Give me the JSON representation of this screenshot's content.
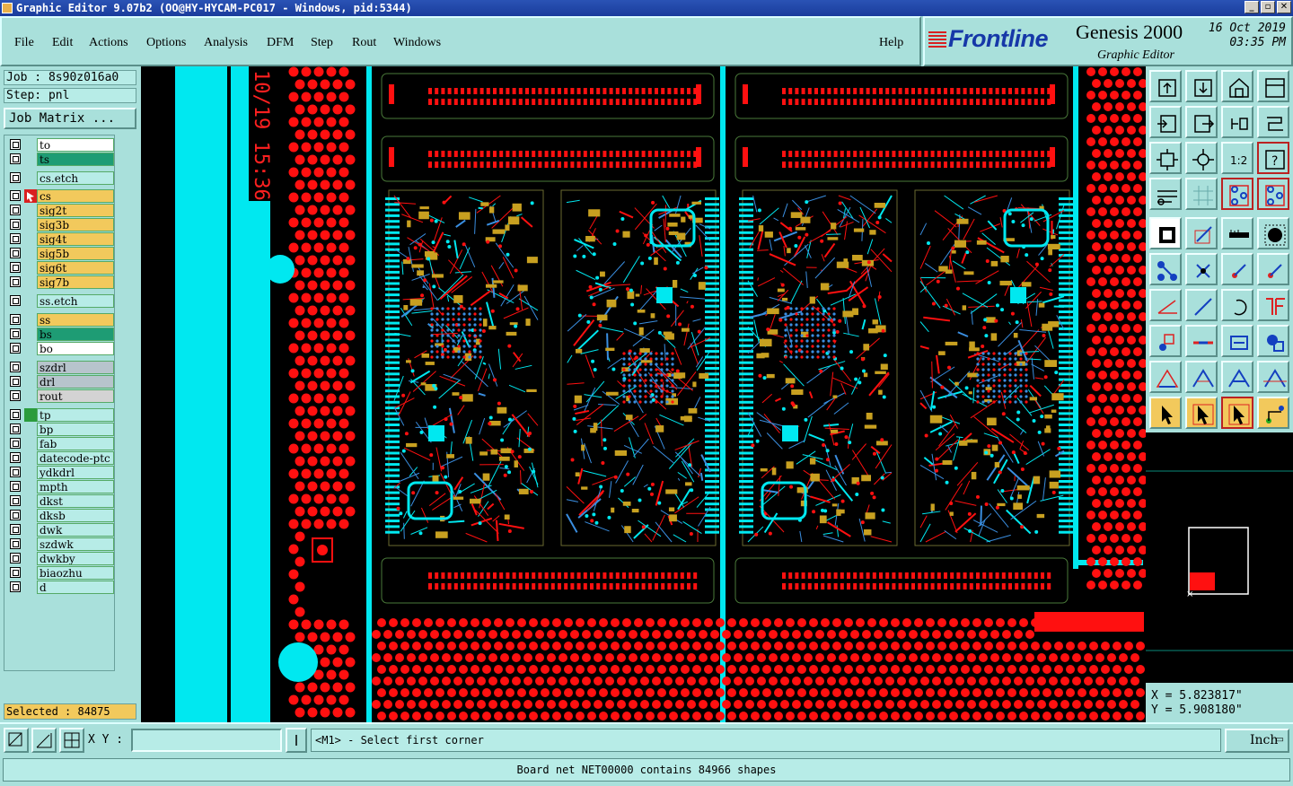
{
  "window": {
    "title": "Graphic Editor 9.07b2 (OO@HY-HYCAM-PC017 - Windows, pid:5344)"
  },
  "menu": [
    "File",
    "Edit",
    "Actions",
    "Options",
    "Analysis",
    "DFM",
    "Step",
    "Rout",
    "Windows"
  ],
  "help_label": "Help",
  "brand": {
    "logo": "Frontline",
    "product": "Genesis 2000",
    "subtitle": "Graphic Editor",
    "date": "16 Oct 2019",
    "time": "03:35 PM"
  },
  "job": {
    "label": "Job : 8s90z016a0",
    "step": "Step: pnl",
    "matrix_button": "Job Matrix ..."
  },
  "layers": [
    {
      "name": "to",
      "color": "#ffffff"
    },
    {
      "name": "ts",
      "color": "#1e9c74"
    },
    {
      "name": "cs.etch",
      "color": "#b7ece7"
    },
    {
      "name": "cs",
      "color": "#f2c95c",
      "active": true
    },
    {
      "name": "sig2t",
      "color": "#f2c95c"
    },
    {
      "name": "sig3b",
      "color": "#f2c95c"
    },
    {
      "name": "sig4t",
      "color": "#f2c95c"
    },
    {
      "name": "sig5b",
      "color": "#f2c95c"
    },
    {
      "name": "sig6t",
      "color": "#f2c95c"
    },
    {
      "name": "sig7b",
      "color": "#f2c95c"
    },
    {
      "name": "ss.etch",
      "color": "#b7ece7"
    },
    {
      "name": "ss",
      "color": "#f2c95c"
    },
    {
      "name": "bs",
      "color": "#1e9c74"
    },
    {
      "name": "bo",
      "color": "#ffffff"
    },
    {
      "name": "szdrl",
      "color": "#b7c4cc"
    },
    {
      "name": "drl",
      "color": "#b7c4cc"
    },
    {
      "name": "rout",
      "color": "#d3d3d3"
    },
    {
      "name": "tp",
      "color": "#b7ece7",
      "marked": true
    },
    {
      "name": "bp",
      "color": "#b7ece7"
    },
    {
      "name": "fab",
      "color": "#b7ece7"
    },
    {
      "name": "datecode-ptc",
      "color": "#b7ece7"
    },
    {
      "name": "ydkdrl",
      "color": "#b7ece7"
    },
    {
      "name": "mpth",
      "color": "#b7ece7"
    },
    {
      "name": "dkst",
      "color": "#b7ece7"
    },
    {
      "name": "dksb",
      "color": "#b7ece7"
    },
    {
      "name": "dwk",
      "color": "#b7ece7"
    },
    {
      "name": "szdwk",
      "color": "#b7ece7"
    },
    {
      "name": "dwkby",
      "color": "#b7ece7"
    },
    {
      "name": "biaozhu",
      "color": "#b7ece7"
    },
    {
      "name": "d",
      "color": "#b7ece7"
    }
  ],
  "selected": "Selected : 84875",
  "canvas": {
    "datecode": "10/19 15:36",
    "colors": {
      "copper": "#ff1010",
      "outline": "#00e8f0",
      "gold": "#c8a020",
      "trace_blue": "#3a8ee0",
      "background": "#000000"
    }
  },
  "coords": {
    "x": "X = 5.823817\"",
    "y": "Y = 5.908180\""
  },
  "command": {
    "xy_label": "X Y :",
    "xy_value": "",
    "prompt": "<M1> - Select first corner",
    "units": "Inch"
  },
  "status": "Board net NET00000 contains 84966 shapes",
  "tools": [
    "open-step-icon",
    "save-icon",
    "home-icon",
    "window-icon",
    "zoom-in-icon",
    "zoom-out-icon",
    "undo-icon",
    "redo-icon",
    "fit-screen-icon",
    "fit-profile-icon",
    "scale-1-2-icon",
    "help-icon",
    "measure-icon",
    "grid-icon",
    "snap-icon",
    "snap-all-icon",
    "pad-icon",
    "line-icon",
    "ruler-icon",
    "fill-icon",
    "net-select-icon",
    "cross-icon",
    "link-icon",
    "link-alt-icon",
    "angle-icon",
    "diagonal-icon",
    "arc-icon",
    "feature-icon",
    "move-icon",
    "minus-icon",
    "dimension-icon",
    "copy-icon",
    "triangle-icon",
    "triangle-line-icon",
    "arch-icon",
    "arch-line-icon",
    "pointer-icon",
    "select-icon",
    "select-alt-icon",
    "tree-icon"
  ]
}
